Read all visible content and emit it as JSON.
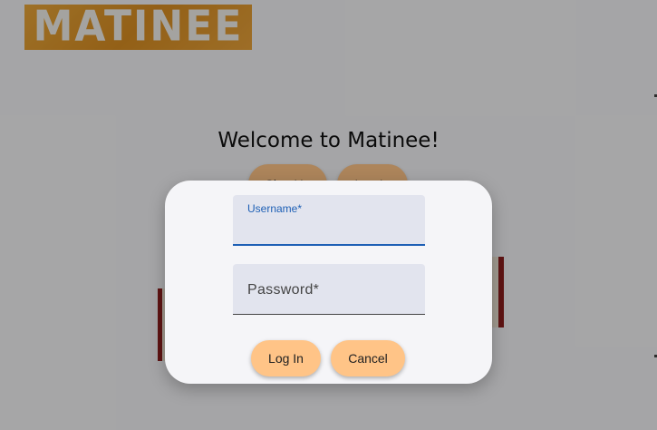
{
  "app": {
    "logo_text": "MATINEE"
  },
  "landing": {
    "welcome": "Welcome to Matinee!",
    "sign_up_label": "Sign Up",
    "log_in_label": "Log In"
  },
  "dialog": {
    "username_label": "Username*",
    "username_value": "",
    "password_label": "Password*",
    "password_value": "",
    "login_button": "Log In",
    "cancel_button": "Cancel"
  },
  "colors": {
    "accent_button": "#ffc487",
    "focus_blue": "#1d5fb5",
    "logo_bg": "#e09a2e"
  }
}
